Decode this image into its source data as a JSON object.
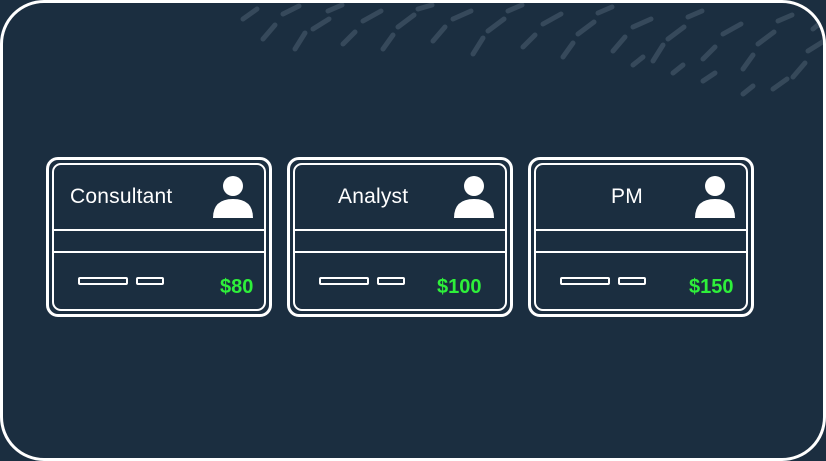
{
  "cards": [
    {
      "role": "Consultant",
      "price": "$80"
    },
    {
      "role": "Analyst",
      "price": "$100"
    },
    {
      "role": "PM",
      "price": "$150"
    }
  ],
  "icons": {
    "person": "person-icon"
  },
  "colors": {
    "background": "#1b2e40",
    "stroke": "#ffffff",
    "price": "#2ef03a",
    "texture": "#3b4e60"
  }
}
